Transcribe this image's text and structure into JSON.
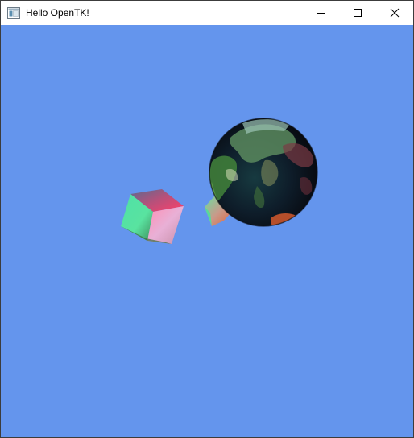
{
  "window": {
    "title": "Hello OpenTK!",
    "app_icon": "window-app-icon",
    "controls": {
      "minimize_icon": "minimize-icon",
      "maximize_icon": "maximize-icon",
      "close_icon": "close-icon"
    }
  },
  "scene": {
    "background_color": "#6495ED",
    "objects": [
      {
        "type": "cube",
        "name": "rotating-cube-large"
      },
      {
        "type": "cube",
        "name": "rotating-cube-small"
      },
      {
        "type": "sphere",
        "name": "earth-globe",
        "texture": "earth"
      }
    ]
  }
}
